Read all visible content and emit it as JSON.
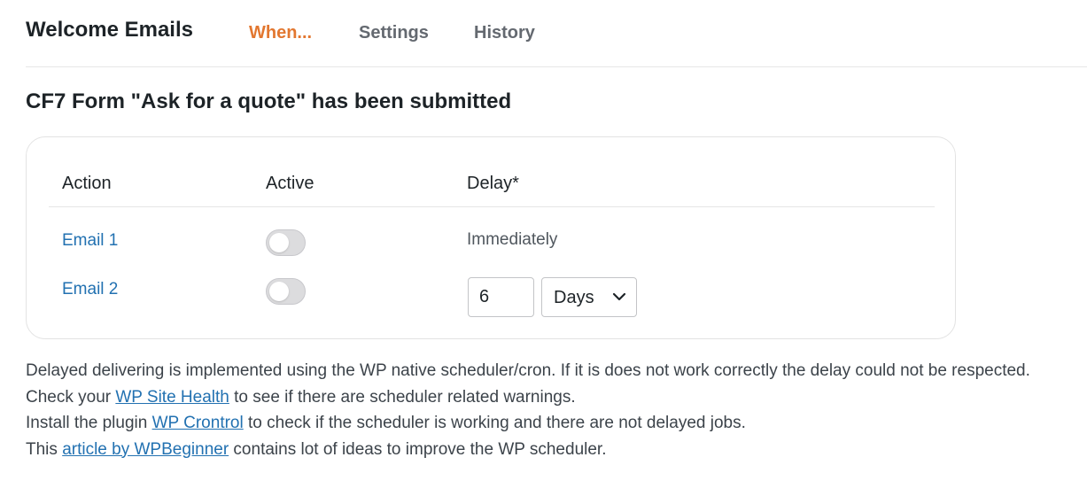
{
  "header": {
    "title": "Welcome Emails",
    "tabs": [
      {
        "label": "When...",
        "active": true
      },
      {
        "label": "Settings",
        "active": false
      },
      {
        "label": "History",
        "active": false
      }
    ],
    "active_tab_color": "#e27730"
  },
  "section": {
    "title": "CF7 Form \"Ask for a quote\" has been submitted"
  },
  "table": {
    "columns": [
      "Action",
      "Active",
      "Delay*"
    ],
    "rows": [
      {
        "action": "Email 1",
        "active": false,
        "delay_text": "Immediately"
      },
      {
        "action": "Email 2",
        "active": false,
        "delay_value": "6",
        "delay_unit": "Days"
      }
    ]
  },
  "notes": {
    "line1": "Delayed delivering is implemented using the WP native scheduler/cron. If it is does not work correctly the delay could not be respected.",
    "line2_pre": "Check your ",
    "line2_link": "WP Site Health",
    "line2_post": " to see if there are scheduler related warnings.",
    "line3_pre": "Install the plugin ",
    "line3_link": "WP Crontrol",
    "line3_post": " to check if the scheduler is working and there are not delayed jobs.",
    "line4_pre": "This ",
    "line4_link": "article by WPBeginner",
    "line4_post": " contains lot of ideas to improve the WP scheduler."
  },
  "colors": {
    "link": "#2271b1",
    "accent": "#e27730"
  }
}
